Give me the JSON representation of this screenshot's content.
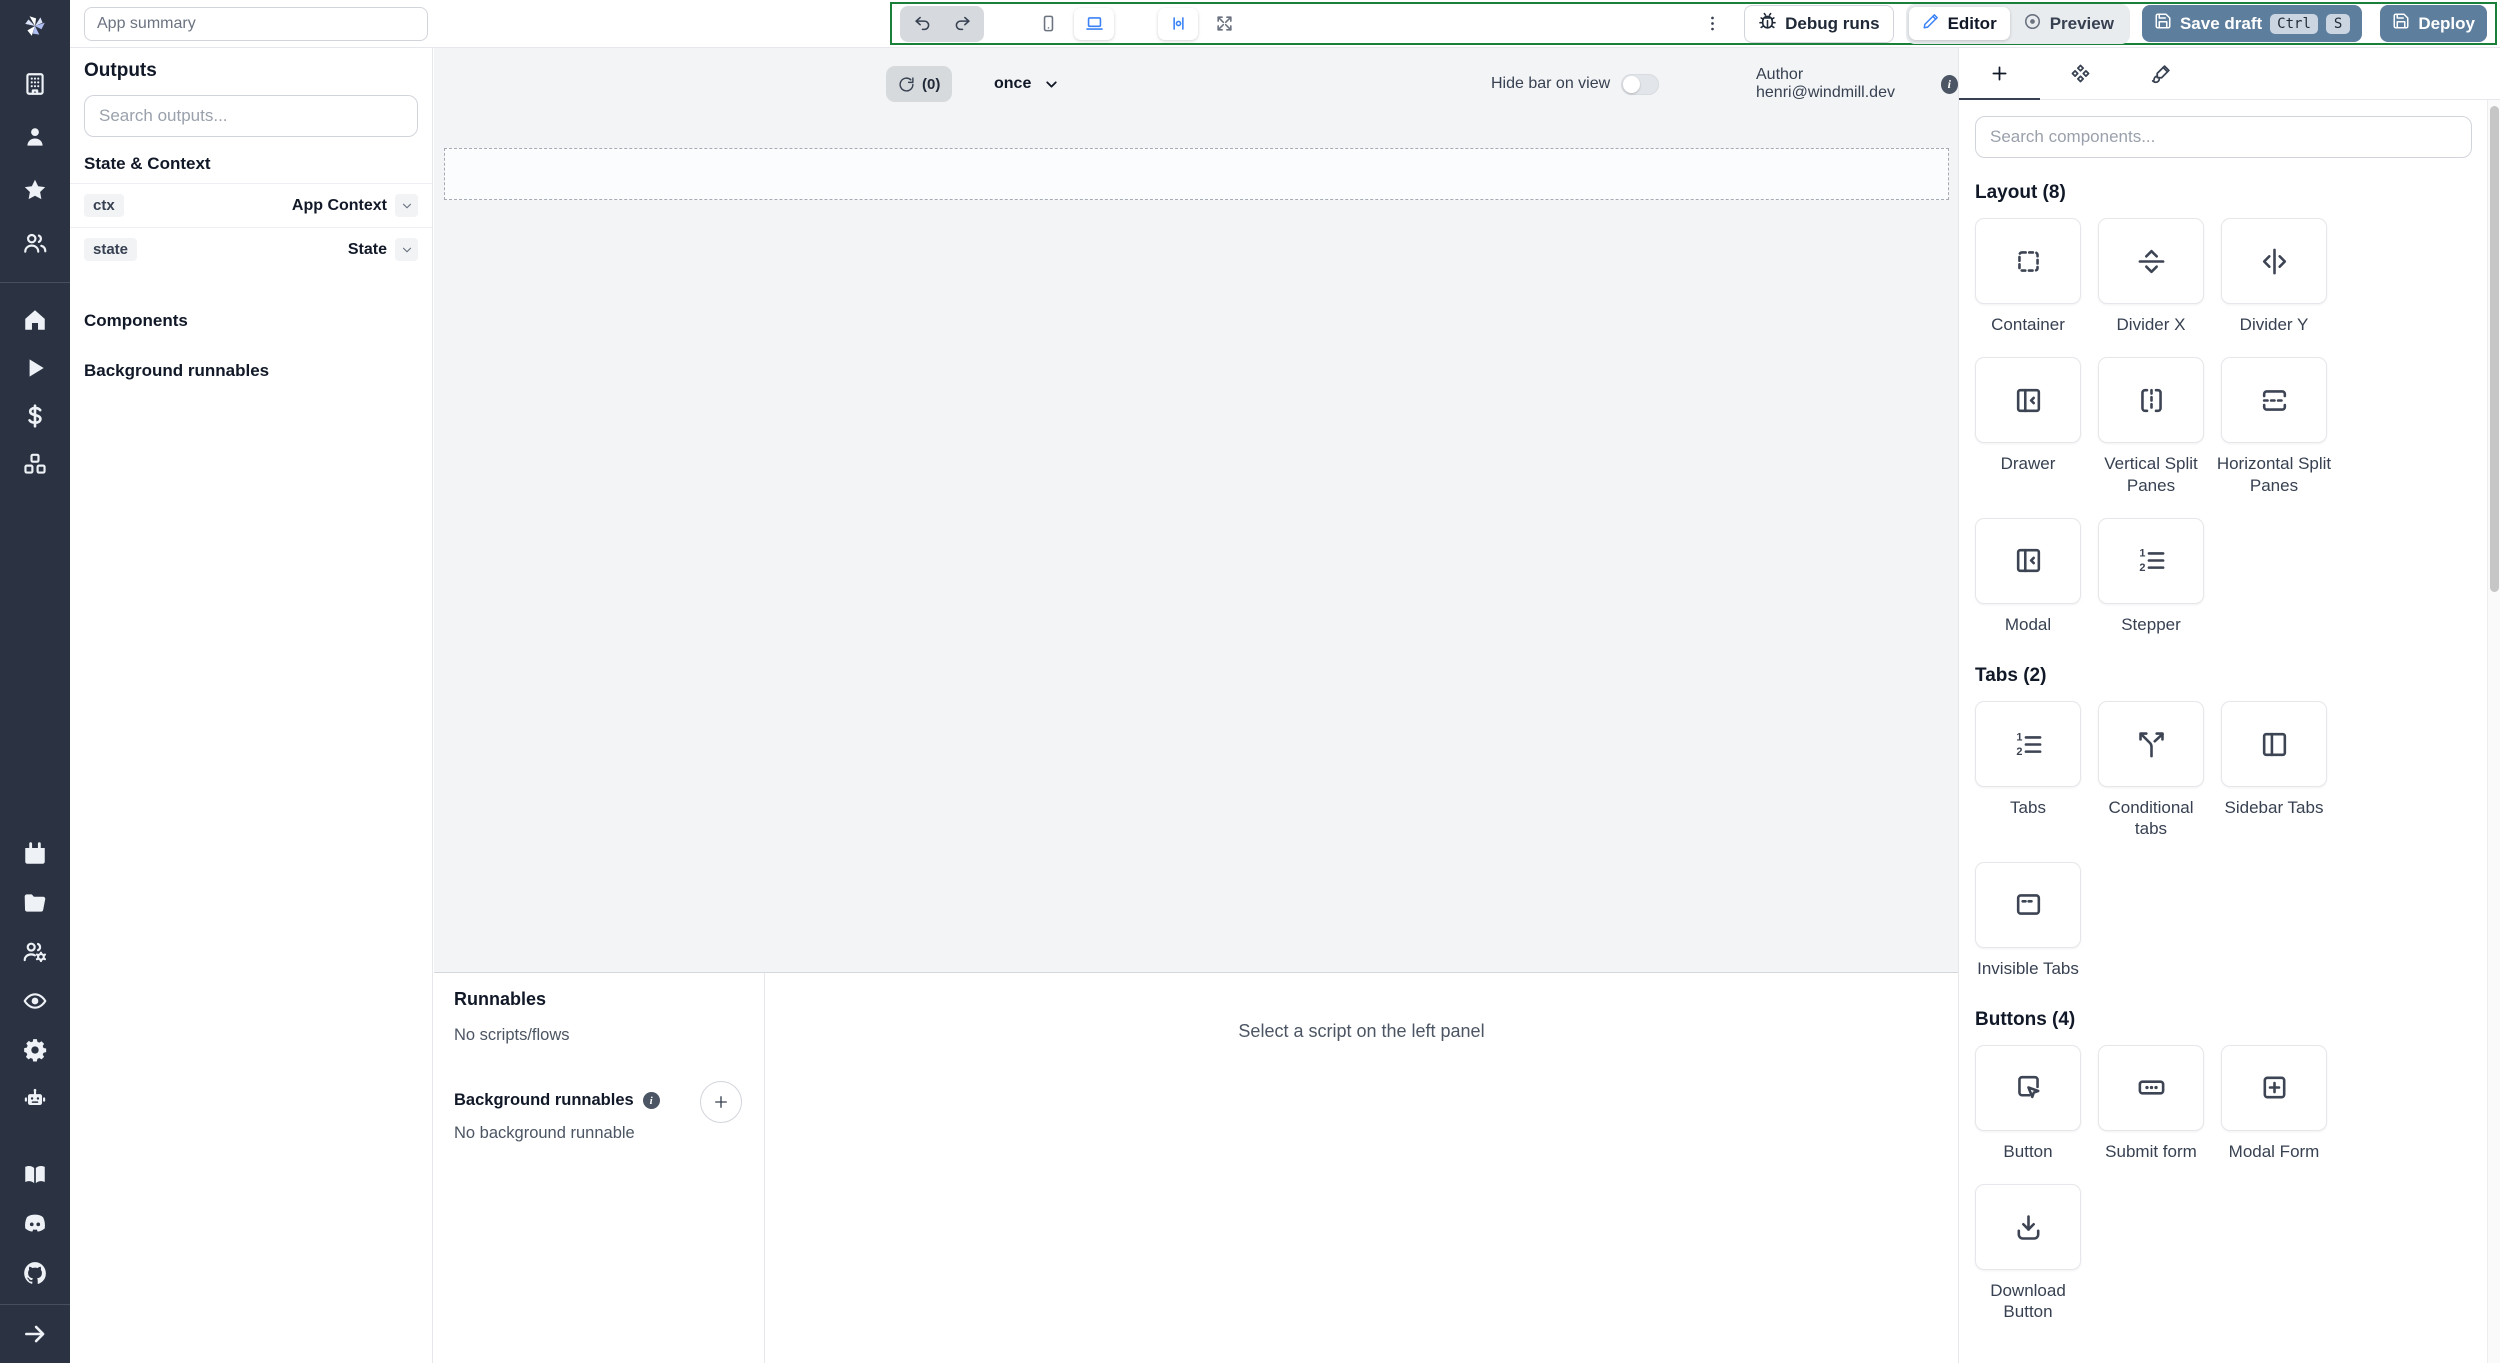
{
  "topbar": {
    "app_summary_placeholder": "App summary",
    "debug_runs_label": "Debug runs",
    "editor_label": "Editor",
    "preview_label": "Preview",
    "save_draft_label": "Save draft",
    "shortcut_ctrl": "Ctrl",
    "shortcut_s": "S",
    "deploy_label": "Deploy",
    "toolbar_icons": [
      "undo-icon",
      "redo-icon",
      "smartphone-icon",
      "laptop-icon",
      "align-zero-icon",
      "maximize-icon",
      "kebab-menu-icon",
      "bug-icon",
      "pencil-icon",
      "eye-icon",
      "save-icon"
    ]
  },
  "sidebar": {
    "icons": [
      "windmill-logo",
      "building-icon",
      "user-icon",
      "star-icon",
      "users-icon",
      "home-icon",
      "play-icon",
      "dollar-icon",
      "resources-cubes-icon",
      "calendar-icon",
      "folder-icon",
      "users-gear-icon",
      "eye-audit-icon",
      "gear-icon",
      "robot-icon",
      "book-icon",
      "discord-icon",
      "github-icon",
      "collapse-arrow-icon"
    ]
  },
  "outputs_panel": {
    "title": "Outputs",
    "search_placeholder": "Search outputs...",
    "state_context_title": "State & Context",
    "rows": [
      {
        "key": "ctx",
        "value": "App Context"
      },
      {
        "key": "state",
        "value": "State"
      }
    ],
    "components_title": "Components",
    "background_runnables_title": "Background runnables"
  },
  "canvas": {
    "refresh_count": "(0)",
    "refresh_mode": "once",
    "hide_bar_label": "Hide bar on view",
    "author_label": "Author henri@windmill.dev"
  },
  "runnables_panel": {
    "title": "Runnables",
    "empty_scripts": "No scripts/flows",
    "background_title": "Background runnables",
    "empty_background": "No background runnable",
    "select_hint": "Select a script on the left panel"
  },
  "components_panel": {
    "search_placeholder": "Search components...",
    "sections": [
      {
        "title": "Layout (8)",
        "items": [
          {
            "label": "Container",
            "icon": "container-dashed-icon"
          },
          {
            "label": "Divider X",
            "icon": "separator-horizontal-icon"
          },
          {
            "label": "Divider Y",
            "icon": "separator-vertical-icon"
          },
          {
            "label": "Drawer",
            "icon": "panel-left-close-icon"
          },
          {
            "label": "Vertical Split Panes",
            "icon": "split-vertical-icon"
          },
          {
            "label": "Horizontal Split Panes",
            "icon": "split-horizontal-icon"
          },
          {
            "label": "Modal",
            "icon": "panel-left-close-icon"
          },
          {
            "label": "Stepper",
            "icon": "list-ordered-icon"
          }
        ]
      },
      {
        "title": "Tabs (2)",
        "items": [
          {
            "label": "Tabs",
            "icon": "list-ordered-icon"
          },
          {
            "label": "Conditional tabs",
            "icon": "branch-split-icon"
          },
          {
            "label": "Sidebar Tabs",
            "icon": "panel-left-icon"
          },
          {
            "label": "Invisible Tabs",
            "icon": "window-dashed-icon"
          }
        ]
      },
      {
        "title": "Buttons (4)",
        "items": [
          {
            "label": "Button",
            "icon": "mouse-pointer-square-icon"
          },
          {
            "label": "Submit form",
            "icon": "rectangle-ellipsis-icon"
          },
          {
            "label": "Modal Form",
            "icon": "square-plus-icon"
          },
          {
            "label": "Download Button",
            "icon": "download-icon"
          }
        ]
      }
    ]
  },
  "colors": {
    "accent_green": "#188038",
    "primary_blue": "#3b82f6",
    "action_blue_gray": "#5e7e9d",
    "sidebar_bg": "#2b3342",
    "canvas_bg": "#f3f4f6"
  }
}
